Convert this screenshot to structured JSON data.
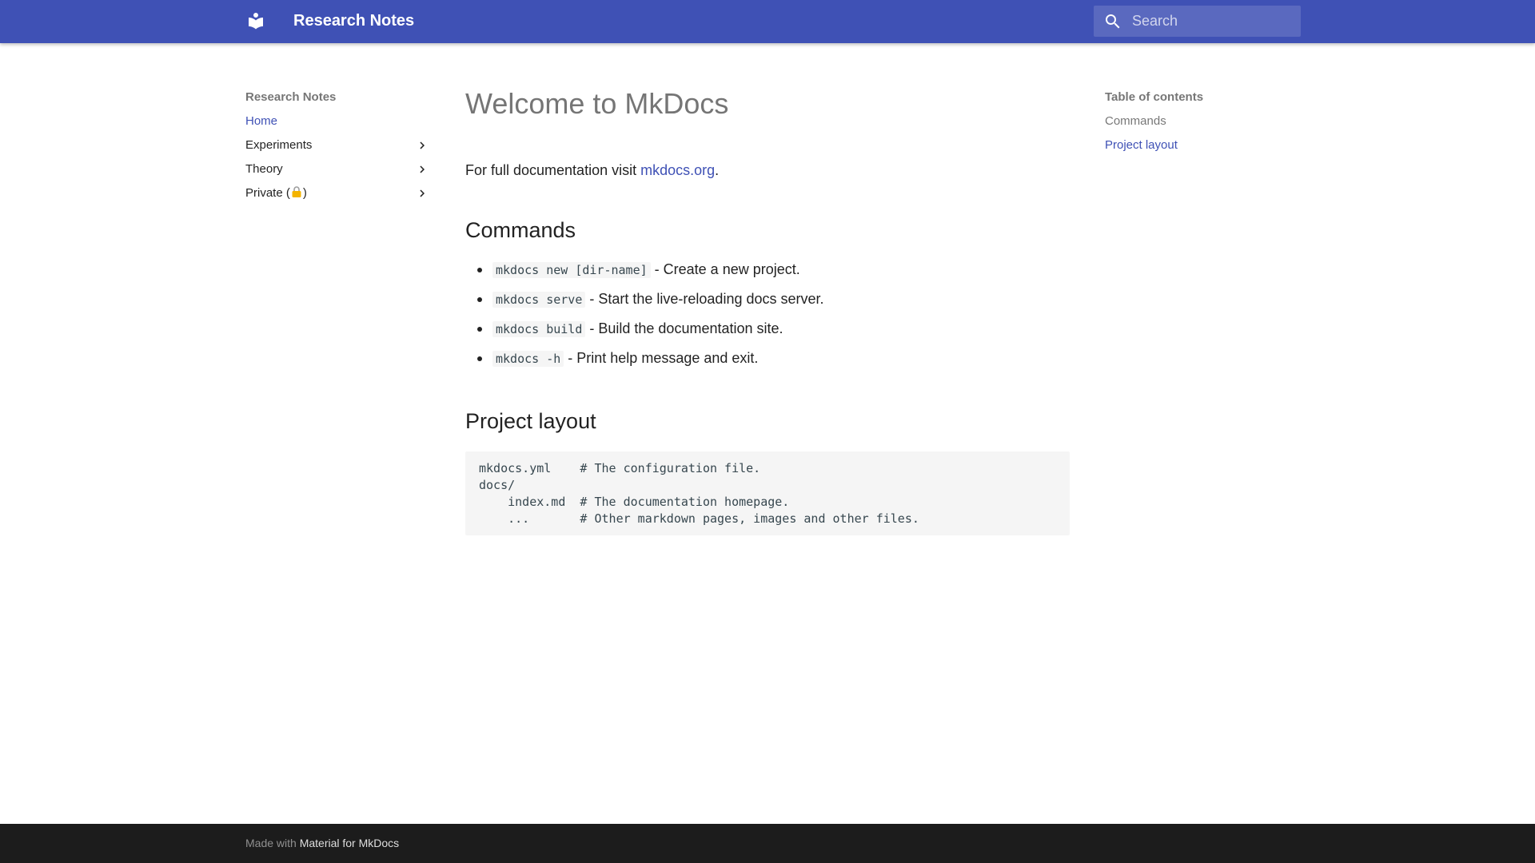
{
  "header": {
    "site_title": "Research Notes",
    "logo_icon": "material-logo-icon",
    "search_placeholder": "Search",
    "color": "#3f51b5"
  },
  "nav": {
    "title": "Research Notes",
    "items": [
      {
        "label": "Home",
        "active": true,
        "expandable": false
      },
      {
        "label": "Experiments",
        "active": false,
        "expandable": true
      },
      {
        "label": "Theory",
        "active": false,
        "expandable": true
      },
      {
        "label_prefix": "Private (",
        "label_suffix": ")",
        "icon": "lock-icon",
        "active": false,
        "expandable": true
      }
    ]
  },
  "main": {
    "title": "Welcome to MkDocs",
    "intro_text": "For full documentation visit ",
    "intro_link": "mkdocs.org",
    "intro_end": ".",
    "commands_heading": "Commands",
    "commands": [
      {
        "code": "mkdocs new [dir-name]",
        "desc": " - Create a new project."
      },
      {
        "code": "mkdocs serve",
        "desc": " - Start the live-reloading docs server."
      },
      {
        "code": "mkdocs build",
        "desc": " - Build the documentation site."
      },
      {
        "code": "mkdocs -h",
        "desc": " - Print help message and exit."
      }
    ],
    "layout_heading": "Project layout",
    "layout_code": "mkdocs.yml    # The configuration file.\ndocs/\n    index.md  # The documentation homepage.\n    ...       # Other markdown pages, images and other files."
  },
  "toc": {
    "title": "Table of contents",
    "items": [
      {
        "label": "Commands",
        "active": false
      },
      {
        "label": "Project layout",
        "active": true
      }
    ]
  },
  "footer": {
    "made_with": "Made with ",
    "link": "Material for MkDocs"
  }
}
